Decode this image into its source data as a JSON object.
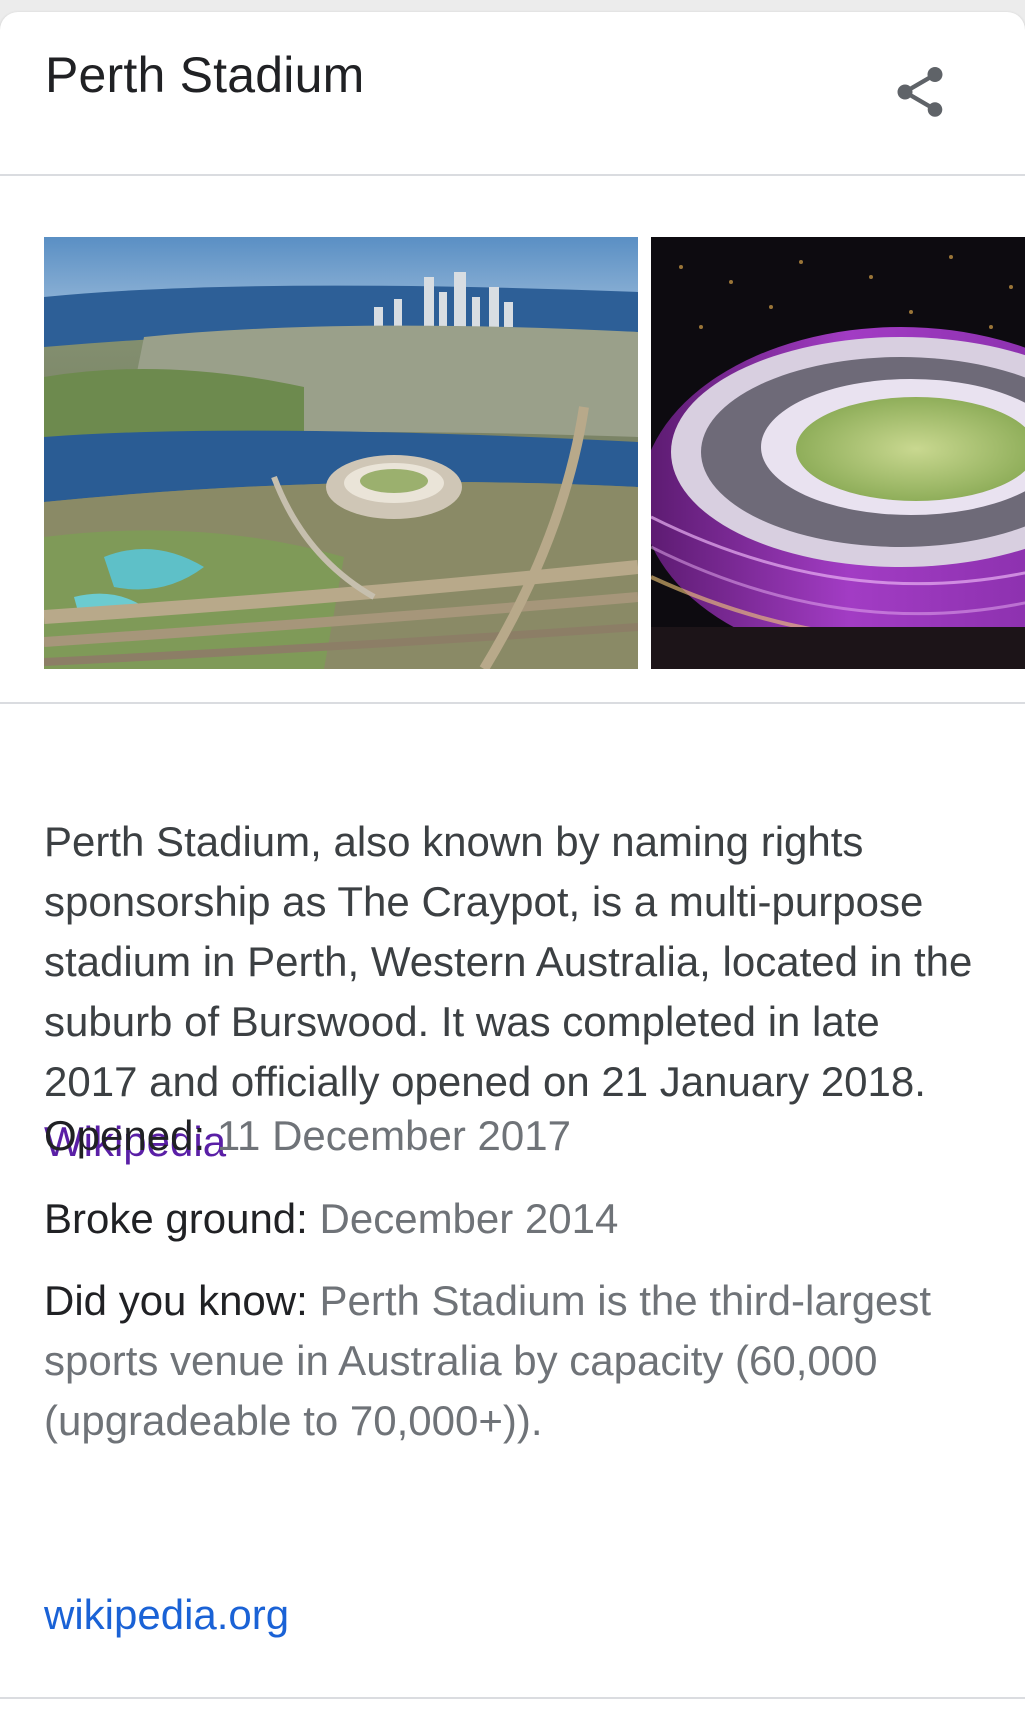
{
  "panel": {
    "title": "Perth Stadium",
    "share_icon": "share-icon"
  },
  "images": [
    {
      "alt": "",
      "kind": "aerial-photo"
    },
    {
      "alt": "",
      "kind": "night-photo"
    }
  ],
  "description": {
    "text": "Perth Stadium, also known by naming rights sponsorship as The Craypot, is a multi-purpose stadium in Perth, Western Australia, located in the suburb of Burswood. It was completed in late 2017 and officially opened on 21 January 2018.",
    "source_label": "Wikipedia"
  },
  "facts": [
    {
      "label": "Opened:",
      "value": "11 December 2017"
    },
    {
      "label": "Broke ground:",
      "value": "December 2014"
    },
    {
      "label": "Did you know:",
      "value": "Perth Stadium is the third-largest sports venue in Australia by capacity (60,000 (upgradeable to 70,000+))."
    }
  ],
  "did_you_know_source": "wikipedia.org",
  "colors": {
    "link_visited": "#5a1fa6",
    "link": "#1a62d6",
    "text_primary": "#202124",
    "text_secondary": "#6f7378",
    "divider": "#dadce0"
  }
}
